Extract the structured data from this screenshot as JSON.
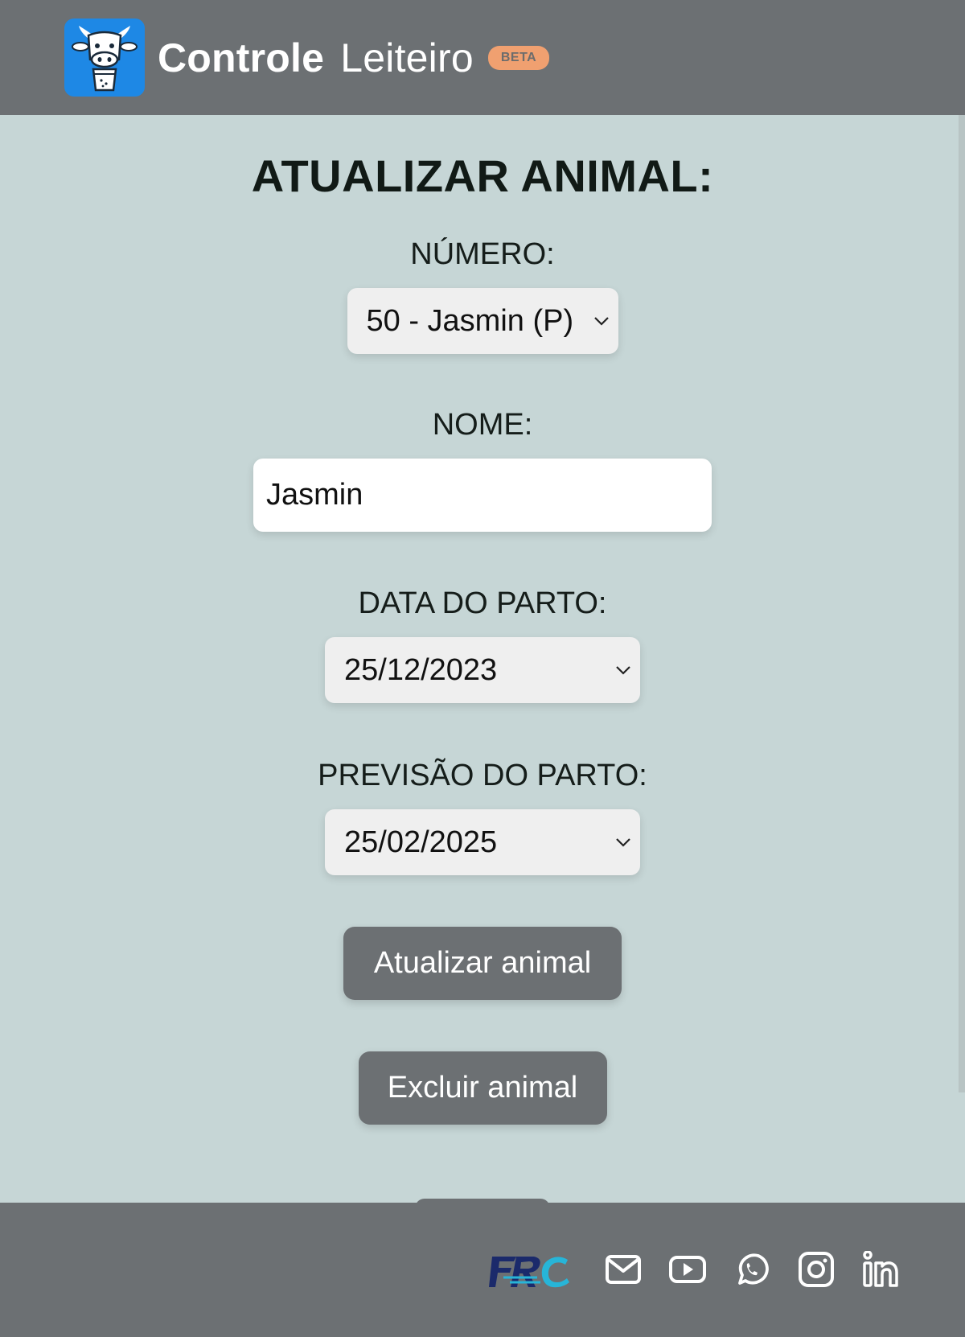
{
  "header": {
    "brand_bold": "Controle",
    "brand_light": "Leiteiro",
    "badge": "BETA"
  },
  "page": {
    "title": "ATUALIZAR ANIMAL:"
  },
  "form": {
    "numero_label": "NÚMERO:",
    "numero_value": "50 - Jasmin (P)",
    "nome_label": "NOME:",
    "nome_value": "Jasmin",
    "data_parto_label": "DATA DO PARTO:",
    "data_parto_value": "25/12/2023",
    "previsao_label": "PREVISÃO DO PARTO:",
    "previsao_value": "25/02/2025"
  },
  "buttons": {
    "update": "Atualizar animal",
    "delete": "Excluir animal"
  },
  "footer": {
    "icons": [
      "frc-logo-icon",
      "mail-icon",
      "youtube-icon",
      "whatsapp-icon",
      "instagram-icon",
      "linkedin-icon"
    ]
  },
  "colors": {
    "header_bg": "#6c7073",
    "page_bg": "#c6d6d6",
    "logo_bg": "#1e88e5",
    "badge_bg": "#f0a070"
  }
}
